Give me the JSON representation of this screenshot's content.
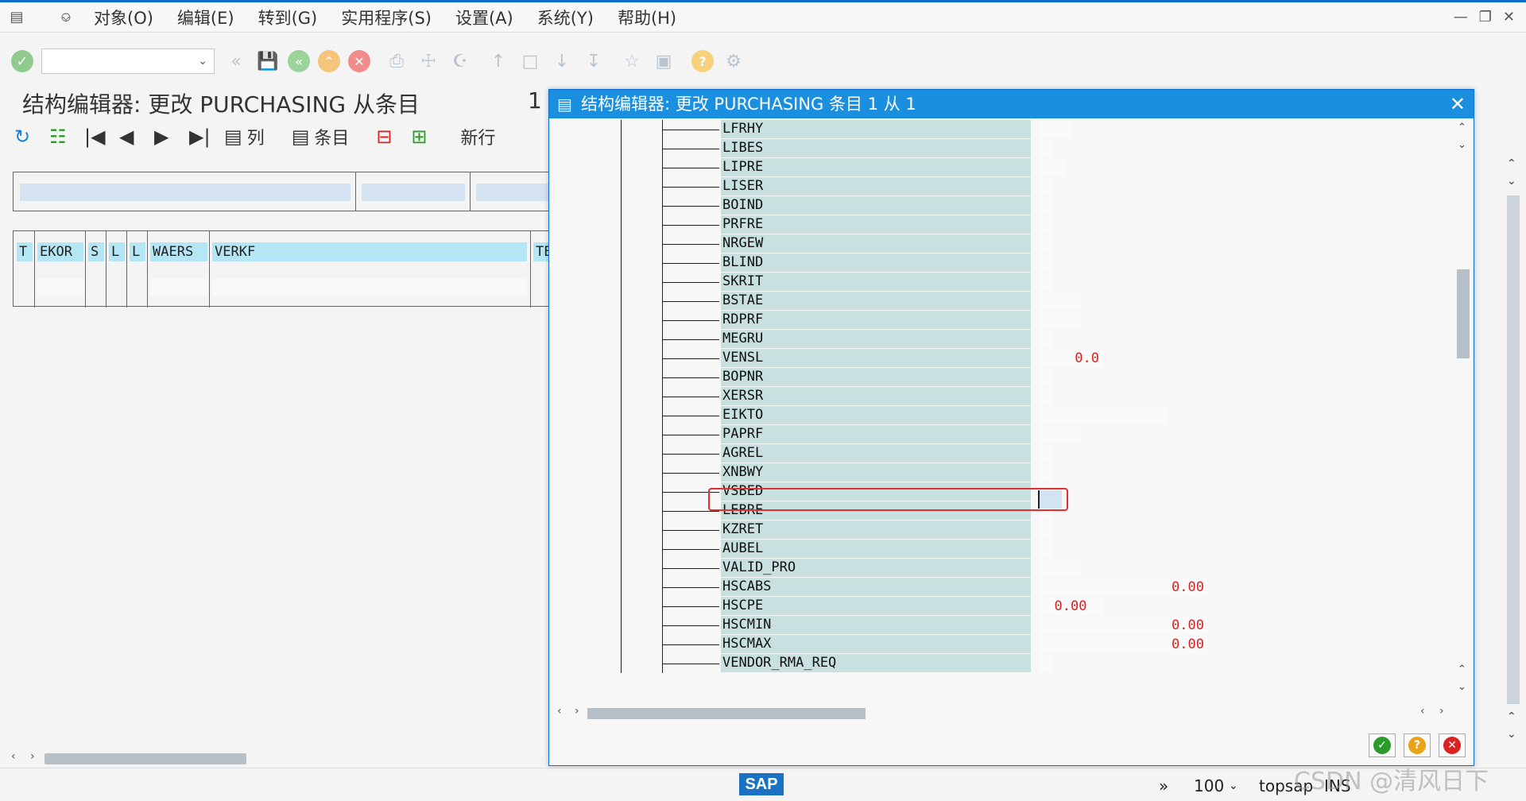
{
  "menu": {
    "items": [
      "对象(O)",
      "编辑(E)",
      "转到(G)",
      "实用程序(S)",
      "设置(A)",
      "系统(Y)",
      "帮助(H)"
    ]
  },
  "page": {
    "title": "结构编辑器: 更改 PURCHASING 从条目",
    "title_count": "1"
  },
  "app_toolbar": {
    "columns_label": "列",
    "entries_label": "条目",
    "newline_label": "新行"
  },
  "grid": {
    "columns": [
      "T",
      "EKOR",
      "S",
      "L",
      "L",
      "WAERS",
      "VERKF",
      "TE"
    ]
  },
  "dialog": {
    "title": "结构编辑器: 更改 PURCHASING 条目 1 从 1",
    "rows": [
      {
        "name": "LFRHY",
        "value": ""
      },
      {
        "name": "LIBES",
        "value": ""
      },
      {
        "name": "LIPRE",
        "value": ""
      },
      {
        "name": "LISER",
        "value": ""
      },
      {
        "name": "BOIND",
        "value": ""
      },
      {
        "name": "PRFRE",
        "value": ""
      },
      {
        "name": "NRGEW",
        "value": ""
      },
      {
        "name": "BLIND",
        "value": ""
      },
      {
        "name": "SKRIT",
        "value": ""
      },
      {
        "name": "BSTAE",
        "value": ""
      },
      {
        "name": "RDPRF",
        "value": ""
      },
      {
        "name": "MEGRU",
        "value": ""
      },
      {
        "name": "VENSL",
        "value": "0.0"
      },
      {
        "name": "BOPNR",
        "value": ""
      },
      {
        "name": "XERSR",
        "value": ""
      },
      {
        "name": "EIKTO",
        "value": ""
      },
      {
        "name": "PAPRF",
        "value": ""
      },
      {
        "name": "AGREL",
        "value": ""
      },
      {
        "name": "XNBWY",
        "value": ""
      },
      {
        "name": "VSBED",
        "value": ""
      },
      {
        "name": "LEBRE",
        "value": ""
      },
      {
        "name": "KZRET",
        "value": ""
      },
      {
        "name": "AUBEL",
        "value": ""
      },
      {
        "name": "VALID_PRO",
        "value": ""
      },
      {
        "name": "HSCABS",
        "value": "0.00"
      },
      {
        "name": "HSCPE",
        "value": "0.00"
      },
      {
        "name": "HSCMIN",
        "value": "0.00"
      },
      {
        "name": "HSCMAX",
        "value": "0.00"
      },
      {
        "name": "VENDOR_RMA_REQ",
        "value": ""
      }
    ]
  },
  "status": {
    "zoom": "100",
    "user": "topsap",
    "mode": "INS",
    "logo": "SAP"
  },
  "watermark": "CSDN @清风日下",
  "colors": {
    "title_bar": "#1a8fe0",
    "field_bg": "#c8e0e0",
    "value_text": "#dd2222",
    "highlight_border": "#e03030"
  }
}
